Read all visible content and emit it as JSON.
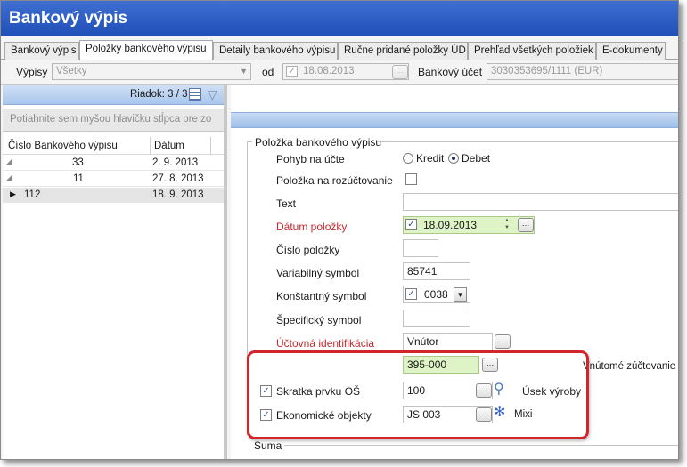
{
  "window": {
    "title": "Bankový výpis"
  },
  "tabs": [
    {
      "label": "Bankový výpis"
    },
    {
      "label": "Položky bankového výpisu"
    },
    {
      "label": "Detaily bankového výpisu"
    },
    {
      "label": "Ručne pridané položky ÚD"
    },
    {
      "label": "Prehľad všetkých položiek"
    },
    {
      "label": "E-dokumenty"
    }
  ],
  "toolbar": {
    "vypisy_label": "Výpisy",
    "vypisy_value": "Všetky",
    "od_label": "od",
    "od_value": "18.08.2013",
    "ucet_label": "Bankový účet",
    "ucet_value": "3030353695/1111 (EUR)"
  },
  "left": {
    "row_counter": "Riadok: 3 / 3",
    "group_hint": "Potiahnite sem myšou hlavičku stĺpca pre zo",
    "columns": {
      "c1": "Číslo Bankového výpisu",
      "c2": "Dátum"
    },
    "rows": [
      {
        "num": "33",
        "date": "2. 9. 2013"
      },
      {
        "num": "11",
        "date": "27. 8. 2013"
      },
      {
        "num": "112",
        "date": "18. 9. 2013"
      }
    ]
  },
  "form": {
    "section_title": "Položka bankového výpisu",
    "pohyb_label": "Pohyb na účte",
    "kredit": "Kredit",
    "debet": "Debet",
    "rozuctovanie_label": "Položka na rozúčtovanie",
    "text_label": "Text",
    "datum_label": "Dátum položky",
    "datum_value": "18.09.2013",
    "cislo_label": "Číslo položky",
    "variabilny_label": "Variabilný symbol",
    "variabilny_value": "85741",
    "konstantny_label": "Konštantný symbol",
    "konstantny_value": "0038",
    "specificky_label": "Špecifický symbol",
    "uctovna_label": "Účtovná identifikácia",
    "uctovna_value": "Vnútor",
    "account_value": "395-000",
    "vnutorne": "Vnútomé zúčtovanie",
    "skratka_label": "Skratka prvku OŠ",
    "skratka_value": "100",
    "usek": "Úsek výroby",
    "ekonomicke_label": "Ekonomické objekty",
    "ekonomicke_value": "JS 003",
    "mixi": "Mixi",
    "suma_label": "Suma"
  },
  "colors": {
    "title_bar": "#2a5bc4",
    "highlight": "#d1242b",
    "required": "#c8262c",
    "field_green": "#dff4c6"
  }
}
